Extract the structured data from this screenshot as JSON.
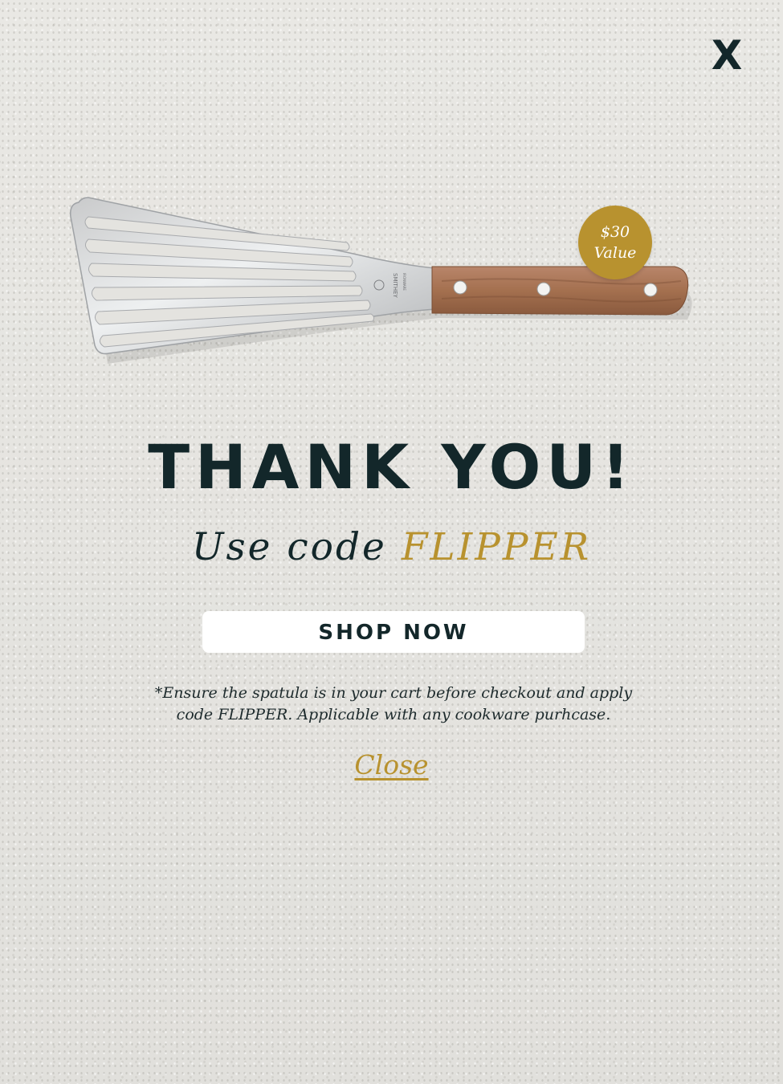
{
  "modal": {
    "close_icon_label": "X",
    "badge": {
      "line1": "$30",
      "line2": "Value"
    },
    "headline": "THANK YOU!",
    "code_prefix": "Use code",
    "code": "FLIPPER",
    "shop_button_label": "SHOP NOW",
    "disclaimer_line1": "*Ensure the spatula is in your cart before checkout and apply",
    "disclaimer_line2": "code FLIPPER. Applicable with any cookware purhcase.",
    "close_link_label": "Close"
  },
  "product": {
    "brand_mark": "SMITHEY",
    "brand_sub": "IRONWARE"
  },
  "colors": {
    "accent_gold": "#b8922f",
    "text_dark": "#13272a",
    "background": "#e4e3df",
    "button_bg": "#ffffff"
  },
  "icons": {
    "close": "close-x-icon"
  }
}
